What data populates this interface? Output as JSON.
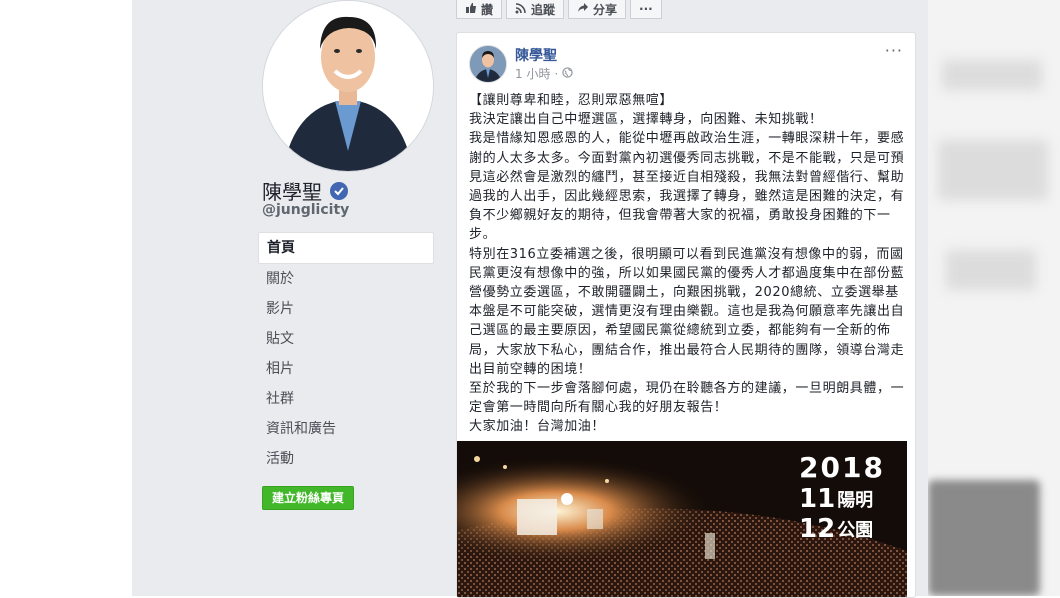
{
  "profile": {
    "name": "陳學聖",
    "handle": "@junglicity"
  },
  "nav": {
    "items": [
      {
        "label": "首頁",
        "active": true
      },
      {
        "label": "關於"
      },
      {
        "label": "影片"
      },
      {
        "label": "貼文"
      },
      {
        "label": "相片"
      },
      {
        "label": "社群"
      },
      {
        "label": "資訊和廣告"
      },
      {
        "label": "活動"
      }
    ],
    "create_page_label": "建立粉絲專頁"
  },
  "actions": {
    "like_label": "讚",
    "follow_label": "追蹤",
    "share_label": "分享",
    "more_label": "···"
  },
  "post": {
    "author": "陳學聖",
    "time": "1 小時",
    "more_label": "···",
    "paragraphs": [
      "【讓則尊卑和睦，忍則眾惡無喧】",
      "我決定讓出自己中壢選區，選擇轉身，向困難、未知挑戰！",
      "我是惜緣知恩感恩的人，能從中壢再啟政治生涯，一轉眼深耕十年，要感謝的人太多太多。今面對黨內初選優秀同志挑戰，不是不能戰，只是可預見這必然會是激烈的纏鬥，甚至接近自相殘殺，我無法對曾經偕行、幫助過我的人出手，因此幾經思索，我選擇了轉身，雖然這是困難的決定，有負不少鄉親好友的期待，但我會帶著大家的祝福，勇敢投身困難的下一步。",
      "特別在316立委補選之後，很明顯可以看到民進黨沒有想像中的弱，而國民黨更沒有想像中的強，所以如果國民黨的優秀人才都過度集中在部份藍營優勢立委選區，不敢開疆闢土，向艱困挑戰，2020總統、立委選舉基本盤是不可能突破，選情更沒有理由樂觀。這也是我為何願意率先讓出自己選區的最主要原因，希望國民黨從總統到立委，都能夠有一全新的佈局，大家放下私心，團結合作，推出最符合人民期待的團隊，領導台灣走出目前空轉的困境！",
      "至於我的下一步會落腳何處，現仍在聆聽各方的建議，一旦明朗具體，一定會第一時間向所有關心我的好朋友報告！",
      "大家加油！台灣加油！"
    ],
    "photo_badge": {
      "year": "2018",
      "month": "11",
      "place_top": "陽明",
      "day": "12",
      "place_bottom": "公園"
    }
  },
  "colors": {
    "link": "#365899",
    "green": "#42b72a",
    "verified": "#4267b2",
    "background": "#e9ebee"
  }
}
